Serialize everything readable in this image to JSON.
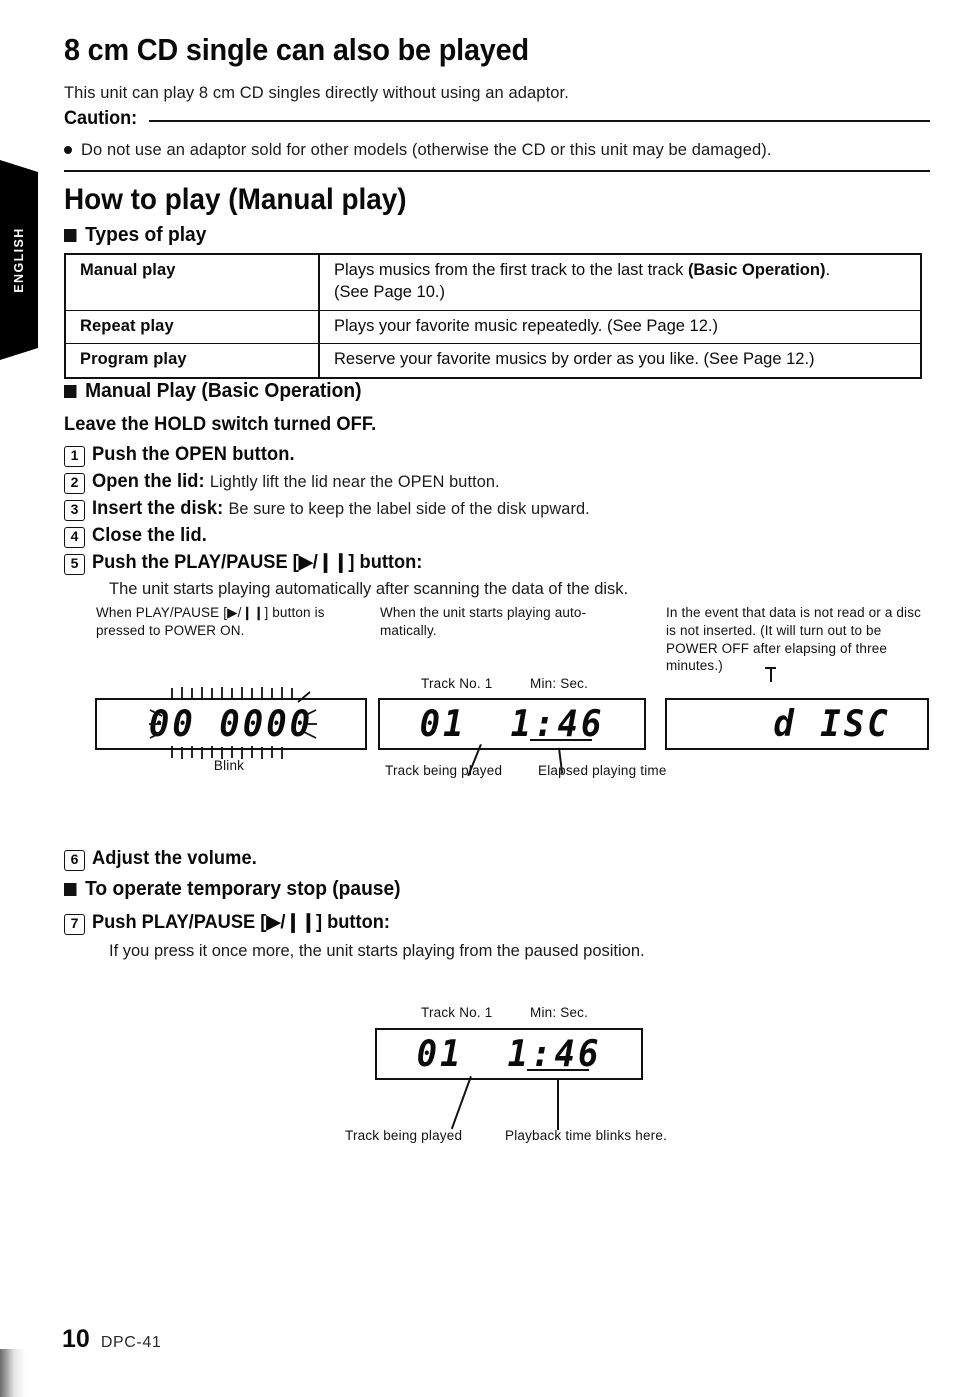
{
  "language_tab": {
    "label": "ENGLISH"
  },
  "section_8cm": {
    "title": "8 cm CD single can also be played",
    "intro": "This unit can play 8 cm CD singles directly without using an adaptor.",
    "caution_label": "Caution:",
    "caution_bullet": "Do not use an adaptor sold for other models (otherwise the CD or this unit may be damaged)."
  },
  "section_howto": {
    "title": "How to play (Manual play)",
    "types_heading": "Types of play",
    "table": {
      "rows": [
        {
          "name": "Manual play",
          "desc_pre": "Plays musics from the first track to the last track ",
          "desc_bold": "(Basic Operation)",
          "desc_post": ".",
          "desc_line2": "(See Page 10.)"
        },
        {
          "name": "Repeat play",
          "desc_pre": "Plays your favorite music repeatedly. (See Page 12.)",
          "desc_bold": "",
          "desc_post": "",
          "desc_line2": ""
        },
        {
          "name": "Program play",
          "desc_pre": "Reserve your favorite musics by order as you like. (See Page 12.)",
          "desc_bold": "",
          "desc_post": "",
          "desc_line2": ""
        }
      ]
    }
  },
  "manual_play": {
    "heading": "Manual Play (Basic Operation)",
    "hold_note": "Leave the HOLD switch turned OFF.",
    "steps": [
      {
        "num": "1",
        "bold": "Push the OPEN button.",
        "light": ""
      },
      {
        "num": "2",
        "bold": "Open the lid:",
        "light": "Lightly lift the lid near the OPEN button."
      },
      {
        "num": "3",
        "bold": "Insert the disk:",
        "light": "Be sure to keep the label side of the disk upward."
      },
      {
        "num": "4",
        "bold": "Close the lid.",
        "light": ""
      },
      {
        "num": "5",
        "bold": "Push the PLAY/PAUSE [▶/❙❙] button:",
        "light": ""
      }
    ],
    "step5_note": "The unit starts playing automatically after scanning the data of the disk."
  },
  "displays": {
    "panel1": {
      "caption": "When PLAY/PAUSE [▶/❙❙] button is pressed to POWER ON.",
      "value": "00 0000",
      "below_label": "Blink"
    },
    "panel2": {
      "caption": "When the unit starts playing auto-matically.",
      "top_label_left": "Track No. 1",
      "top_label_right": "Min: Sec.",
      "track_value": "01",
      "time_value": "1:46",
      "leader_left": "Track being played",
      "leader_right": "Elapsed playing time"
    },
    "panel3": {
      "caption": "In the event that data is not read or a disc is not inserted. (It will turn out to be POWER OFF after elapsing of three minutes.)",
      "value": "d ISC"
    }
  },
  "pause_section": {
    "step6": {
      "num": "6",
      "bold": "Adjust the volume.",
      "light": ""
    },
    "heading": "To operate temporary stop (pause)",
    "step7": {
      "num": "7",
      "bold": "Push PLAY/PAUSE [▶/❙❙] button:",
      "light": ""
    },
    "step7_note": "If you press it once more, the unit starts playing from the paused position.",
    "panel": {
      "top_label_left": "Track No. 1",
      "top_label_right": "Min: Sec.",
      "track_value": "01",
      "time_value": "1:46",
      "leader_left": "Track being played",
      "leader_right": "Playback time blinks here."
    }
  },
  "footer": {
    "page_number": "10",
    "model": "DPC-41"
  }
}
